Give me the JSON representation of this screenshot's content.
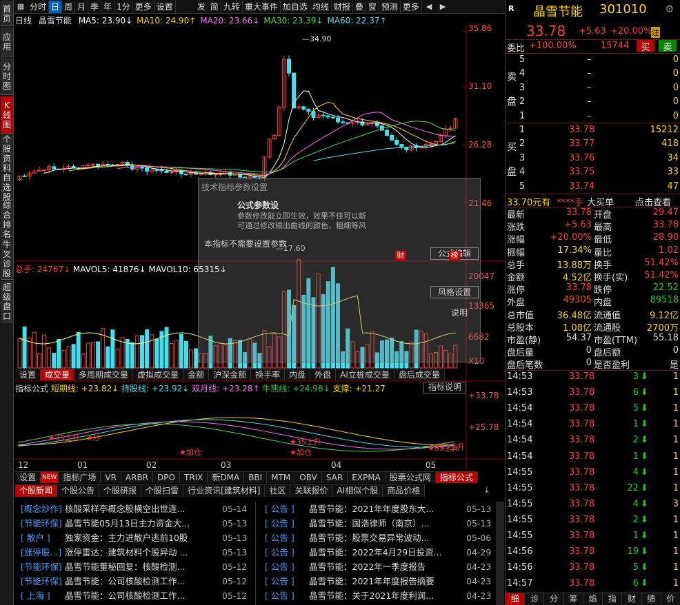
{
  "left_tabs": [
    "首页",
    "应用",
    "分时图",
    "K线图",
    "个股资料",
    "自选股",
    "综合排名",
    "牛叉诊股",
    "超级盘口"
  ],
  "toolbar": {
    "items": [
      "分时",
      "日",
      "周",
      "月",
      "季",
      "年",
      "1分",
      "更多",
      "设置",
      "发",
      "简",
      "九转",
      "重大事件",
      "加自选",
      "均线",
      "财报",
      "叠",
      "窗",
      "预测",
      "更多"
    ]
  },
  "chart": {
    "period": "日线",
    "name": "晶雪节能",
    "ma": [
      {
        "label": "MA5: 23.90↓",
        "color": "#ffffff"
      },
      {
        "label": "MA10: 24.90↑",
        "color": "#ffd700"
      },
      {
        "label": "MA20: 23.66↓",
        "color": "#ff66ff"
      },
      {
        "label": "MA30: 23.39↓",
        "color": "#40e040"
      },
      {
        "label": "MA60: 22.37↑",
        "color": "#3fe0f0"
      }
    ],
    "price_axis": [
      "35.86",
      "31.10",
      "26.28",
      "21.46"
    ],
    "high_label": "34.90",
    "low_label": "17.60",
    "vol_head": {
      "total": "总手: 24767↓",
      "mavol5": "MAVOL5: 41876↓",
      "mavol10": "MAVOL10: 65315↓"
    },
    "vol_axis": [
      "20047",
      "13365",
      "6682",
      "X10"
    ],
    "vol_tabs": [
      "设置",
      "成交量",
      "多周期成交量",
      "虚拟成交量",
      "金额",
      "沪深金额",
      "换手率",
      "内盘",
      "外盘",
      "AI立桩成交量",
      "盘后成交量"
    ],
    "ind_head": {
      "name": "指标公式",
      "short": "短期线: +23.82↓",
      "hold": "持股线: +23.92↓",
      "dbl": "双月线: +23.28↑",
      "bull": "牛熊线: +24.98↓",
      "support": "支撑: +21.27"
    },
    "ind_btn": "指标说明",
    "ind_axis": [
      "+33.78",
      "+25.78"
    ],
    "date_axis": [
      "12",
      "01",
      "02",
      "03",
      "04",
      "05"
    ],
    "ind_tabs": [
      "设置",
      "指标广场",
      "VR",
      "ARBR",
      "DPO",
      "TRIX",
      "新DMA",
      "BBI",
      "MTM",
      "OBV",
      "SAR",
      "EXPMA",
      "股票公式网",
      "指标公式"
    ],
    "new_badge": "NEW",
    "annotations": [
      "35上升",
      "加仓",
      "35上升",
      "加仓",
      "35上升",
      "抄",
      "35上升"
    ],
    "overlay": {
      "title": "技术指标参数设置",
      "item": "公式参数设",
      "text1": "参数修改能立即生效，效果不佳可以新",
      "text2": "可通过修改输出曲线的颜色、粗细等风",
      "text3": "本指标不需要设置参数",
      "btn1": "公式编辑",
      "btn2": "风格设置",
      "btn3": "说明",
      "caib": "财",
      "bang": "榜"
    }
  },
  "news_tabs": [
    "个股新闻",
    "个股公告",
    "个股研报",
    "个股扫雷",
    "行业资讯[建筑材料]",
    "社区",
    "关联报价",
    "AI相似个股",
    "商品价格"
  ],
  "news_left": [
    {
      "cat": "[概念炒作]",
      "title": "核酸采样亭概念股横空出世连...",
      "date": "05-14"
    },
    {
      "cat": "[节能环保]",
      "title": "晶雪节能05月13日主力资金大...",
      "date": "05-13"
    },
    {
      "cat": "[  散户  ]",
      "title": "独家资金：主力进散户逃前10股",
      "date": "05-13"
    },
    {
      "cat": "[涨停股...]",
      "title": "涨停雷达：建筑材料个股异动 ...",
      "date": "05-13"
    },
    {
      "cat": "[节能环保]",
      "title": "晶雪节能董秘回复：核酸检测...",
      "date": "05-12"
    },
    {
      "cat": "[节能环保]",
      "title": "晶雪节能：公司核酸检测工作...",
      "date": "05-12"
    },
    {
      "cat": "[  上海  ]",
      "title": "晶雪节能：公司核酸检测工作...",
      "date": "05-12"
    }
  ],
  "news_right": [
    {
      "cat": "[  公告  ]",
      "title": "晶雪节能：2021年年度股东大...",
      "date": "05-13"
    },
    {
      "cat": "[  公告  ]",
      "title": "晶雪节能：国浩律师（南京）...",
      "date": "05-13"
    },
    {
      "cat": "[  公告  ]",
      "title": "晶雪节能：股票交易异常波动...",
      "date": "05-06"
    },
    {
      "cat": "[  公告  ]",
      "title": "晶雪节能：2022年4月29日投资...",
      "date": "04-29"
    },
    {
      "cat": "[  公告  ]",
      "title": "晶雪节能：2022年一季度报告",
      "date": "04-23"
    },
    {
      "cat": "[  公告  ]",
      "title": "晶雪节能：2021年年度报告摘要",
      "date": "04-23"
    },
    {
      "cat": "[  公告  ]",
      "title": "晶雪节能：关于2021年度利润...",
      "date": "04-23"
    }
  ],
  "quote": {
    "badge": "R",
    "name": "晶雪节能",
    "code": "301010",
    "price": "33.78",
    "chg": "+5.63",
    "pct": "+20.00%",
    "zhu": "注",
    "weibi_label": "委比",
    "weibi": "+100.00%",
    "weicha": "15744",
    "sell_btn": "买",
    "buy_btn": "卖",
    "sell_label": [
      "卖",
      "盘"
    ],
    "buy_label": [
      "买",
      "盘"
    ],
    "sells": [
      {
        "n": "5",
        "p": "–",
        "v": "0"
      },
      {
        "n": "4",
        "p": "–",
        "v": "0"
      },
      {
        "n": "3",
        "p": "–",
        "v": "0"
      },
      {
        "n": "2",
        "p": "–",
        "v": "0"
      },
      {
        "n": "1",
        "p": "–",
        "v": "0"
      }
    ],
    "buys": [
      {
        "n": "1",
        "p": "33.78",
        "v": "15212"
      },
      {
        "n": "2",
        "p": "33.77",
        "v": "418"
      },
      {
        "n": "3",
        "p": "33.76",
        "v": "34"
      },
      {
        "n": "4",
        "p": "33.75",
        "v": "33"
      },
      {
        "n": "5",
        "p": "33.74",
        "v": "47"
      }
    ],
    "bigorder": {
      "price": "33.70元有",
      "vol": "****手",
      "label": "大买单",
      "link": "点击查看"
    },
    "stats": [
      [
        "最新",
        "33.78",
        "开盘",
        "29.47"
      ],
      [
        "涨跌",
        "+5.63",
        "最高",
        "33.78"
      ],
      [
        "涨幅",
        "+20.00%",
        "最低",
        "28.90"
      ],
      [
        "振幅",
        "17.34%",
        "量比",
        "1.02"
      ],
      [
        "总手",
        "13.88万",
        "换手",
        "51.42%"
      ],
      [
        "金额",
        "4.52亿",
        "换手(实)",
        "51.42%"
      ],
      [
        "涨停",
        "33.78",
        "跌停",
        "22.52"
      ],
      [
        "外盘",
        "49305",
        "内盘",
        "89518"
      ],
      [
        "总市值",
        "36.48亿",
        "流通值",
        "9.12亿"
      ],
      [
        "总股本",
        "1.08亿",
        "流通股",
        "2700万"
      ],
      [
        "市盈(静)",
        "54.37",
        "市盈(TTM)",
        "55.18"
      ],
      [
        "盘后量",
        "0",
        "盘后额",
        "0"
      ],
      [
        "盘后笔数",
        "0",
        "是否盈利",
        "是"
      ]
    ],
    "ticks": [
      {
        "t": "14:53",
        "p": "33.78",
        "v": "3",
        "n": "1"
      },
      {
        "t": "14:53",
        "p": "33.78",
        "v": "6",
        "n": "1"
      },
      {
        "t": "14:54",
        "p": "33.78",
        "v": "5",
        "n": "1"
      },
      {
        "t": "14:54",
        "p": "33.78",
        "v": "1",
        "n": "1"
      },
      {
        "t": "14:54",
        "p": "33.78",
        "v": "2",
        "n": "1"
      },
      {
        "t": "14:54",
        "p": "33.78",
        "v": "1",
        "n": "1"
      },
      {
        "t": "14:55",
        "p": "33.78",
        "v": "4",
        "n": "1"
      },
      {
        "t": "14:55",
        "p": "33.78",
        "v": "22",
        "n": "1"
      },
      {
        "t": "14:55",
        "p": "33.78",
        "v": "4",
        "n": "3"
      },
      {
        "t": "14:55",
        "p": "33.78",
        "v": "2",
        "n": "1"
      },
      {
        "t": "14:55",
        "p": "33.78",
        "v": "1",
        "n": "1"
      },
      {
        "t": "14:56",
        "p": "33.78",
        "v": "19",
        "n": "1"
      },
      {
        "t": "14:56",
        "p": "33.78",
        "v": "5",
        "n": "1"
      },
      {
        "t": "14:57",
        "p": "33.78",
        "v": "6",
        "n": "1"
      }
    ],
    "bottom_tabs": [
      "细",
      "诊",
      "分",
      "筹",
      "焰",
      "指",
      "财",
      "绩",
      "价"
    ]
  }
}
